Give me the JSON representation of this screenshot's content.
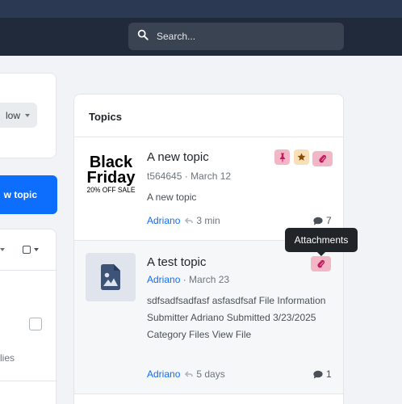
{
  "search": {
    "placeholder": "Search..."
  },
  "sidebar": {
    "follow_label": "low",
    "new_topic_label": "w topic",
    "replies_label": "lies"
  },
  "topics": {
    "heading": "Topics",
    "items": [
      {
        "title": "A new topic",
        "author": "t564645",
        "date": "March 12",
        "excerpt": "A new topic",
        "last_user": "Adriano",
        "last_time": "3 min",
        "reply_count": "7",
        "badges": [
          "pin-icon",
          "star-icon",
          "paperclip-icon"
        ],
        "thumbnail": {
          "line1": "Black",
          "line2": "Friday",
          "line3": "20% OFF SALE"
        }
      },
      {
        "title": "A test topic",
        "author": "Adriano",
        "date": "March 23",
        "excerpt": "sdfsadfsadfasf asfasdfsaf File Information Submitter Adriano Submitted 3/23/2025 Category Files View File",
        "last_user": "Adriano",
        "last_time": "5 days",
        "reply_count": "1",
        "badges": [
          "paperclip-icon"
        ],
        "thumbnail": {
          "icon": "file-image-icon"
        }
      }
    ]
  },
  "tooltip": {
    "text": "Attachments"
  },
  "colors": {
    "navbar": "#212a3a",
    "primary": "#0d6efd",
    "pin_badge": "#f2b6c6",
    "star_badge": "#f9dfb8",
    "badge_icon": "#c2185b"
  }
}
